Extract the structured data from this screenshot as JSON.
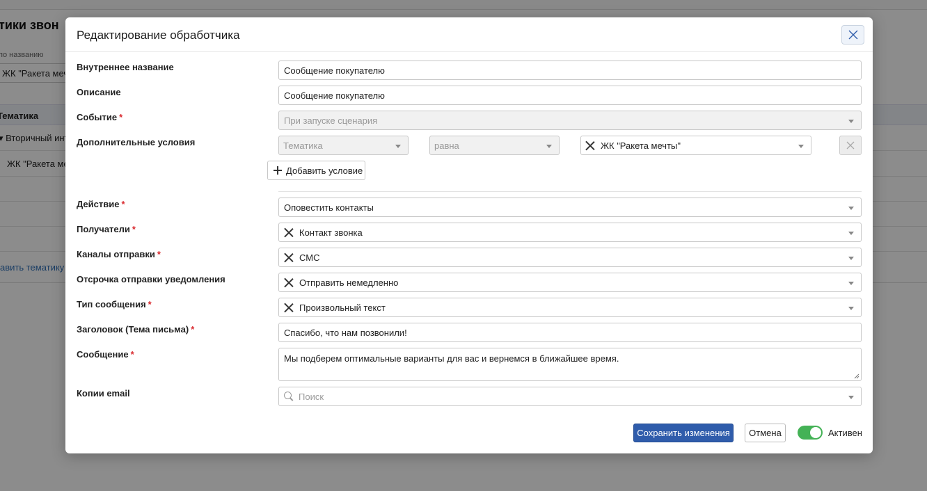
{
  "background": {
    "title": "тики звон",
    "filter_label": "по названию",
    "filter_value": "ЖК \"Ракета мечты",
    "table_header": "Тематика",
    "rows": [
      "▾ Вторичный инт",
      "ЖК \"Ракета ме"
    ],
    "add_link": "авить тематику"
  },
  "modal": {
    "title": "Редактирование обработчика",
    "fields": {
      "internal_name": {
        "label": "Внутреннее название",
        "value": "Сообщение покупателю"
      },
      "description": {
        "label": "Описание",
        "value": "Сообщение покупателю"
      },
      "event": {
        "label": "Событие",
        "value": "При запуске сценария"
      },
      "conditions": {
        "label": "Дополнительные условия",
        "field": "Тематика",
        "operator": "равна",
        "value": "ЖК \"Ракета мечты\"",
        "add_label": "Добавить условие"
      },
      "action": {
        "label": "Действие",
        "value": "Оповестить контакты"
      },
      "recipients": {
        "label": "Получатели",
        "value": "Контакт звонка"
      },
      "channels": {
        "label": "Каналы отправки",
        "value": "СМС"
      },
      "delay": {
        "label": "Отсрочка отправки уведомления",
        "value": "Отправить немедленно"
      },
      "message_type": {
        "label": "Тип сообщения",
        "value": "Произвольный текст"
      },
      "subject": {
        "label": "Заголовок (Тема письма)",
        "value": "Спасибо, что нам позвонили!"
      },
      "message": {
        "label": "Сообщение",
        "value": "Мы подберем оптимальные варианты для вас и вернемся в ближайшее время."
      },
      "cc_email": {
        "label": "Копии email",
        "placeholder": "Поиск"
      }
    },
    "required_mark": "*",
    "footer": {
      "save_label": "Сохранить изменения",
      "cancel_label": "Отмена",
      "active_label": "Активен",
      "active": true
    }
  },
  "colors": {
    "primary": "#2f5cab",
    "toggle_on": "#44b256",
    "required": "#d9292e"
  }
}
